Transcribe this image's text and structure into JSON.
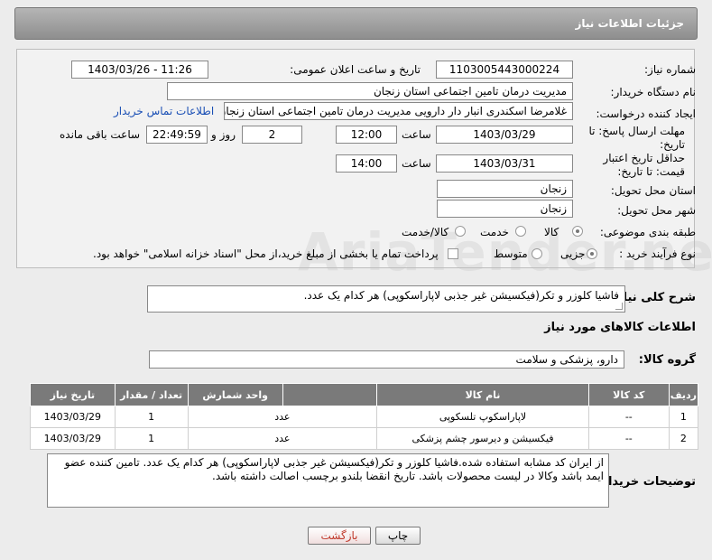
{
  "header": {
    "title": "جزئیات اطلاعات نیاز"
  },
  "labels": {
    "need_number": "شماره نیاز:",
    "announce_datetime": "تاریخ و ساعت اعلان عمومی:",
    "buyer_org": "نام دستگاه خریدار:",
    "requester": "ایجاد کننده درخواست:",
    "reply_deadline": "مهلت ارسال پاسخ: تا تاریخ:",
    "price_validity": "حداقل تاریخ اعتبار قیمت: تا تاریخ:",
    "time_word": "ساعت",
    "days_word": "روز و",
    "remaining_word": "ساعت باقی مانده",
    "province": "استان محل تحویل:",
    "city": "شهر محل تحویل:",
    "category": "طبقه بندی موضوعی:",
    "purchase_type": "نوع فرآیند خرید :",
    "description_title": "شرح کلی نیاز:",
    "goods_info_title": "اطلاعات کالاهای مورد نیاز",
    "goods_group": "گروه کالا:",
    "buyer_notes": "توضیحات خریدار:"
  },
  "fields": {
    "need_number": "1103005443000224",
    "announce_datetime": "1403/03/26 - 11:26",
    "buyer_org": "مدیریت درمان تامین اجتماعی استان زنجان",
    "requester": "غلامرضا  اسکندری انبار دار دارویی مدیریت درمان تامین اجتماعی استان زنجان",
    "contact_link": "اطلاعات تماس خریدار",
    "reply_date": "1403/03/29",
    "reply_time": "12:00",
    "remaining_days": "2",
    "remaining_time": "22:49:59",
    "validity_date": "1403/03/31",
    "validity_time": "14:00",
    "province": "زنجان",
    "city": "زنجان",
    "goods_group": "دارو، پزشکی و سلامت",
    "description": "فاشیا کلوزر و تکر(فیکسیشن غیر جذبی لاپاراسکوپی) هر کدام یک عدد.",
    "buyer_notes": "از ایران کد مشابه استفاده شده.فاشیا کلوزر و تکر(فیکسیشن غیر جذبی لاپاراسکوپی) هر کدام یک عدد. تامین کننده عضو ایمد باشد وکالا در لیست محصولات باشد. تاریخ انقضا بلندو برچسب اصالت داشته باشد."
  },
  "category_options": [
    {
      "label": "کالا",
      "selected": true
    },
    {
      "label": "خدمت",
      "selected": false
    },
    {
      "label": "کالا/خدمت",
      "selected": false
    }
  ],
  "purchase_options": [
    {
      "label": "جزیی",
      "selected": true
    },
    {
      "label": "متوسط",
      "selected": false
    }
  ],
  "payment_note": "پرداخت تمام یا بخشی از مبلغ خرید،از محل \"اسناد خزانه اسلامی\" خواهد بود.",
  "table": {
    "headers": [
      "ردیف",
      "کد کالا",
      "نام کالا",
      "واحد شمارش",
      "تعداد / مقدار",
      "تاریخ نیاز"
    ],
    "rows": [
      [
        "1",
        "--",
        "لاپاراسکوپ تلسکوپی",
        "عدد",
        "1",
        "1403/03/29"
      ],
      [
        "2",
        "--",
        "فیکسیشن و دیرسور چشم پزشکی",
        "عدد",
        "1",
        "1403/03/29"
      ]
    ]
  },
  "buttons": {
    "print": "چاپ",
    "back": "بازگشت"
  },
  "watermark": "AriaTender.neT",
  "colors": {
    "header": "#9a9a9a",
    "table_header": "#7a7a7a",
    "link": "#1a4fb5",
    "back_text": "#c0392b"
  }
}
